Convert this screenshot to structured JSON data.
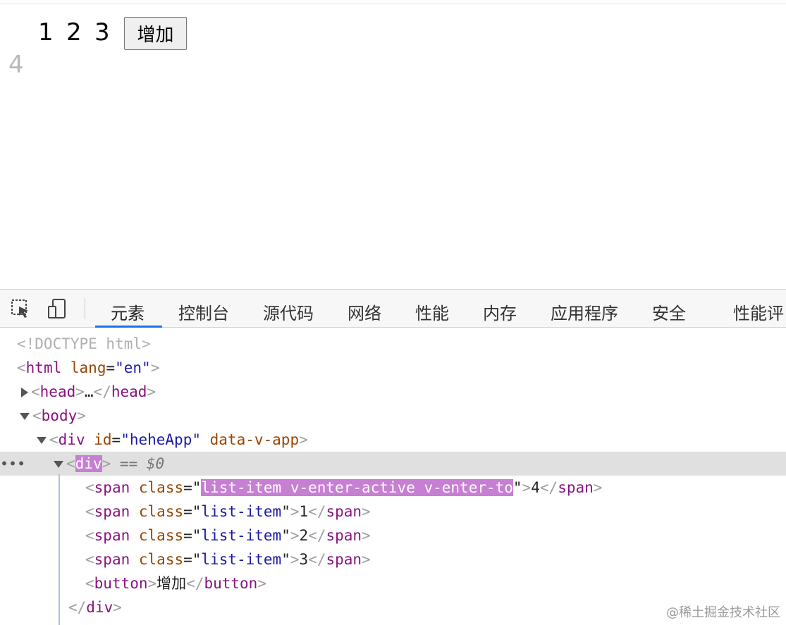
{
  "page": {
    "items": [
      "1",
      "2",
      "3"
    ],
    "add_button_label": "增加",
    "entering_item": "4"
  },
  "devtools": {
    "tabs": [
      "元素",
      "控制台",
      "源代码",
      "网络",
      "性能",
      "内存",
      "应用程序",
      "安全",
      "性能评"
    ],
    "active_tab": "元素",
    "tree": {
      "doctype": "<!DOCTYPE html>",
      "html_tag": "html",
      "html_attr": "lang",
      "html_attr_val": "\"en\"",
      "head_tag": "head",
      "head_ellipsis": "…",
      "body_tag": "body",
      "app_div_tag": "div",
      "app_div_id_attr": "id",
      "app_div_id_val": "\"heheApp\"",
      "app_div_data_attr": "data-v-app",
      "selected_div_tag": "div",
      "selected_marker": "== $0",
      "span_tag": "span",
      "class_attr": "class",
      "entering_class": "list-item v-enter-active v-enter-to",
      "entering_text": "4",
      "list_class": "list-item",
      "span_texts": [
        "1",
        "2",
        "3"
      ],
      "button_tag": "button",
      "button_text": "增加",
      "close_div_tag": "div"
    }
  },
  "watermark": "@稀土掘金技术社区"
}
